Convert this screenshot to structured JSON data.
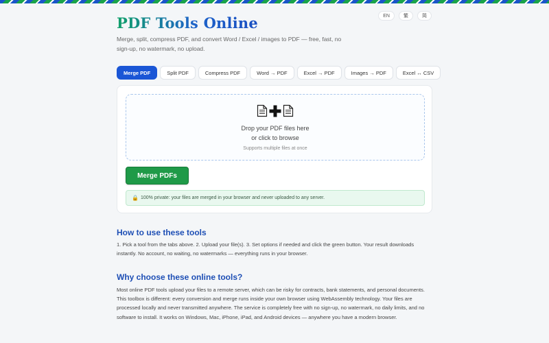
{
  "languages": [
    "EN",
    "繁",
    "简"
  ],
  "header": {
    "title": "PDF Tools Online",
    "subtitle": "Merge, split, compress PDF, and convert Word / Excel / images to PDF — free, fast, no sign-up, no watermark, no upload."
  },
  "tabs": [
    {
      "label": "Merge PDF",
      "active": true
    },
    {
      "label": "Split PDF",
      "active": false
    },
    {
      "label": "Compress PDF",
      "active": false
    },
    {
      "label": "Word → PDF",
      "active": false
    },
    {
      "label": "Excel → PDF",
      "active": false
    },
    {
      "label": "Images → PDF",
      "active": false
    },
    {
      "label": "Excel ↔ CSV",
      "active": false
    }
  ],
  "dropzone": {
    "icons": [
      "document-icon",
      "plus-icon",
      "document-icon"
    ],
    "line1": "Drop your PDF files here",
    "line2": "or click to browse",
    "hint": "Supports multiple files at once"
  },
  "action": {
    "merge_label": "Merge PDFs"
  },
  "privacy": {
    "icon": "lock-icon",
    "text": "100% private: your files are merged in your browser and never uploaded to any server."
  },
  "sections": [
    {
      "heading": "How to use these tools",
      "body": "1. Pick a tool from the tabs above. 2. Upload your file(s). 3. Set options if needed and click the green button. Your result downloads instantly. No account, no waiting, no watermarks — everything runs in your browser."
    },
    {
      "heading": "Why choose these online tools?",
      "body": "Most online PDF tools upload your files to a remote server, which can be risky for contracts, bank statements, and personal documents. This toolbox is different: every conversion and merge runs inside your own browser using WebAssembly technology. Your files are processed locally and never transmitted anywhere. The service is completely free with no sign-up, no watermark, no daily limits, and no software to install. It works on Windows, Mac, iPhone, iPad, and Android devices — anywhere you have a modern browser."
    }
  ],
  "colors": {
    "accent": "#1a56d6",
    "action": "#1f9a48",
    "heading": "#1e4fb5"
  }
}
